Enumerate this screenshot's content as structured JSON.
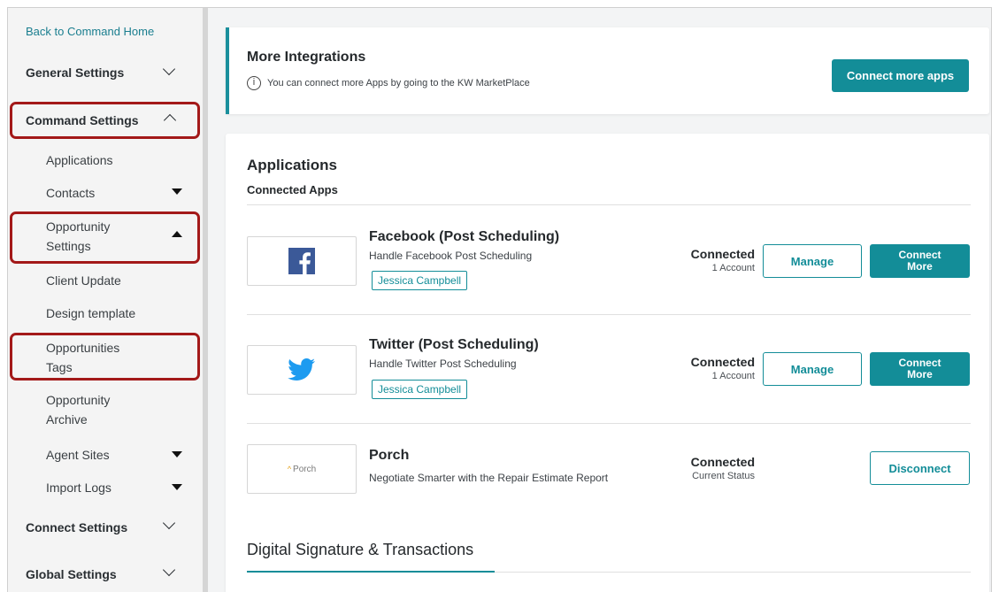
{
  "sidebar": {
    "back_link": "Back to Command Home",
    "general_settings": "General Settings",
    "command_settings": "Command Settings",
    "command_items": {
      "applications": "Applications",
      "contacts": "Contacts",
      "opportunity_settings": "Opportunity Settings",
      "client_update": "Client Update",
      "design_template": "Design template",
      "opportunities_tags": "Opportunities Tags",
      "opportunity_archive": "Opportunity Archive",
      "agent_sites": "Agent Sites",
      "import_logs": "Import Logs"
    },
    "connect_settings": "Connect Settings",
    "global_settings": "Global Settings"
  },
  "integrations": {
    "title": "More Integrations",
    "info_text": "You can connect more Apps by going to the KW MarketPlace",
    "button_label": "Connect more apps"
  },
  "applications": {
    "title": "Applications",
    "subtitle": "Connected Apps",
    "apps": [
      {
        "name": "Facebook (Post Scheduling)",
        "description": "Handle Facebook Post Scheduling",
        "tag": "Jessica Campbell",
        "status": "Connected",
        "status_sub": "1 Account",
        "manage_label": "Manage",
        "connect_more_label": "Connect More",
        "icon": "facebook-icon"
      },
      {
        "name": "Twitter (Post Scheduling)",
        "description": "Handle Twitter Post Scheduling",
        "tag": "Jessica Campbell",
        "status": "Connected",
        "status_sub": "1 Account",
        "manage_label": "Manage",
        "connect_more_label": "Connect More",
        "icon": "twitter-icon"
      },
      {
        "name": "Porch",
        "description": "Negotiate Smarter with the Repair Estimate Report",
        "logo_text": "Porch",
        "status": "Connected",
        "status_sub": "Current Status",
        "disconnect_label": "Disconnect",
        "icon": "porch-logo"
      }
    ]
  },
  "digital_signature": {
    "tab_label": "Digital Signature & Transactions"
  },
  "colors": {
    "accent": "#138d98",
    "highlight": "#a31919",
    "facebook": "#3b5998",
    "twitter": "#1d9bf0"
  }
}
